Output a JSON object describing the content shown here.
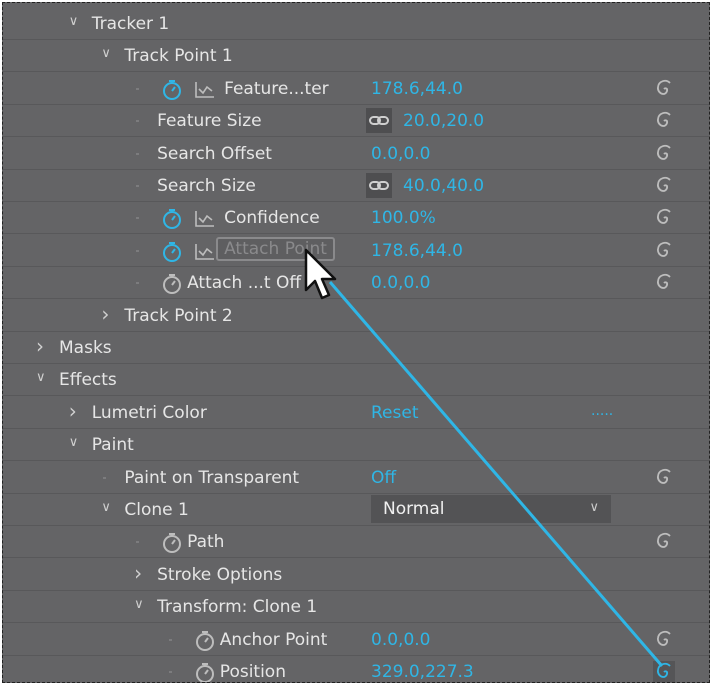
{
  "accent_color": "#2fb6e6",
  "rows": [
    {
      "label": "Tracker 1",
      "level": 1,
      "expand": "open"
    },
    {
      "label": "Track Point 1",
      "level": 2,
      "expand": "open"
    },
    {
      "label": "Feature...ter",
      "level": 3,
      "stopwatch": "active",
      "graph": true,
      "value": "178.6,44.0",
      "spiral": true
    },
    {
      "label": "Feature Size",
      "level": 3,
      "value": "20.0,20.0",
      "link": true,
      "spiral": true
    },
    {
      "label": "Search Offset",
      "level": 3,
      "value": "0.0,0.0",
      "spiral": true
    },
    {
      "label": "Search Size",
      "level": 3,
      "value": "40.0,40.0",
      "link": true,
      "spiral": true
    },
    {
      "label": "Confidence",
      "level": 3,
      "stopwatch": "active",
      "graph": true,
      "value": "100.0%",
      "spiral": true
    },
    {
      "label": "Attach Point",
      "level": 3,
      "stopwatch": "active",
      "graph": true,
      "value": "178.6,44.0",
      "spiral": true,
      "editing": true
    },
    {
      "label": "Attach ...t Off",
      "level": 3,
      "stopwatch": "inactive",
      "value": "0.0,0.0",
      "spiral": true
    },
    {
      "label": "Track Point 2",
      "level": 2,
      "expand": "closed"
    },
    {
      "label": "Masks",
      "level": 0,
      "expand": "closed"
    },
    {
      "label": "Effects",
      "level": 0,
      "expand": "open"
    },
    {
      "label": "Lumetri Color",
      "level": 1,
      "expand": "closed",
      "value": "Reset",
      "extra": "....."
    },
    {
      "label": "Paint",
      "level": 1,
      "expand": "open"
    },
    {
      "label": "Paint on Transparent",
      "level": 2,
      "value": "Off",
      "spiral": true
    },
    {
      "label": "Clone 1",
      "level": 2,
      "expand": "open",
      "dropdown": "Normal"
    },
    {
      "label": "Path",
      "level": 3,
      "stopwatch": "inactive",
      "spiral": true
    },
    {
      "label": "Stroke Options",
      "level": 3,
      "expand": "closed"
    },
    {
      "label": "Transform: Clone 1",
      "level": 3,
      "expand": "open"
    },
    {
      "label": "Anchor Point",
      "level": 4,
      "stopwatch": "inactive",
      "value": "0.0,0.0",
      "spiral": true
    },
    {
      "label": "Position",
      "level": 4,
      "stopwatch": "inactive",
      "value": "329.0,227.3",
      "spiral": true,
      "spiral_active": true
    }
  ]
}
